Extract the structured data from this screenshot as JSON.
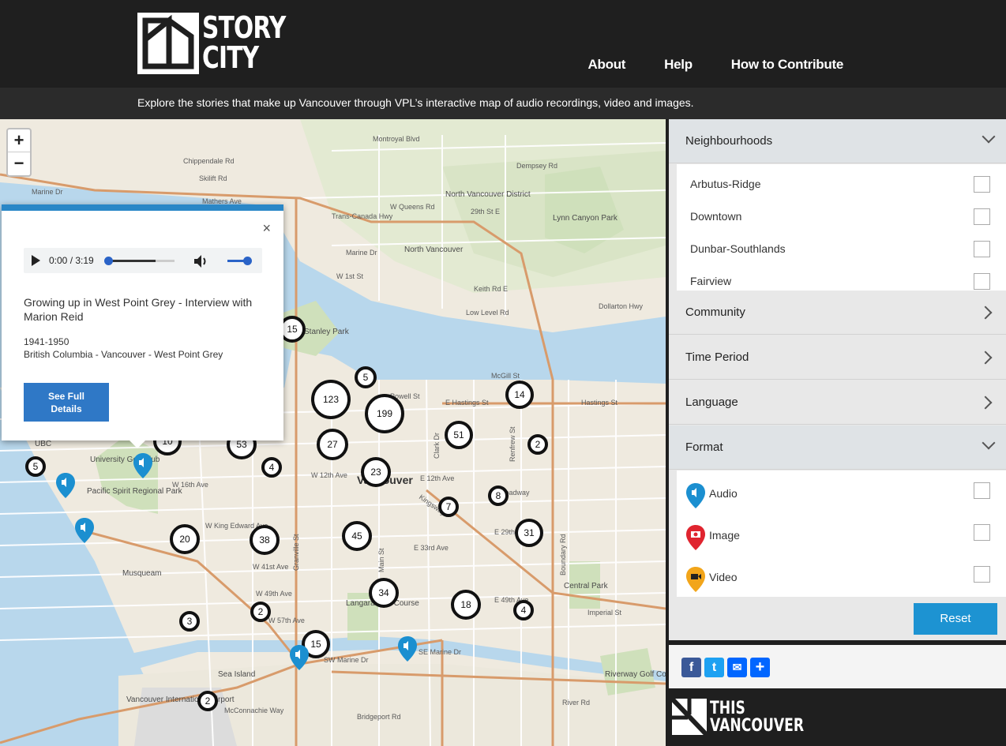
{
  "header": {
    "logo_line1": "STORY",
    "logo_line2": "CITY",
    "nav": [
      "About",
      "Help",
      "How to Contribute"
    ],
    "tagline": "Explore the stories that make up Vancouver through VPL’s interactive map of audio recordings, video and images."
  },
  "map": {
    "zoom_in": "+",
    "zoom_out": "−",
    "place_labels": [
      {
        "text": "North Vancouver District"
      },
      {
        "text": "North Vancouver"
      },
      {
        "text": "Lynn Canyon Park"
      },
      {
        "text": "UBC"
      },
      {
        "text": "University Golf Club"
      },
      {
        "text": "Pacific Spirit Regional Park"
      },
      {
        "text": "Vancouver"
      },
      {
        "text": "Musqueam"
      },
      {
        "text": "Langara Golf Course"
      },
      {
        "text": "Central Park"
      },
      {
        "text": "Sea Island"
      },
      {
        "text": "Vancouver International Airport"
      },
      {
        "text": "Riverway Golf Course"
      },
      {
        "text": "Stanley Park"
      }
    ],
    "street_labels": [
      {
        "text": "Marine Dr"
      },
      {
        "text": "Mathers Ave"
      },
      {
        "text": "Chippendale Rd"
      },
      {
        "text": "Skilift Rd"
      },
      {
        "text": "Montroyal Blvd"
      },
      {
        "text": "Dempsey Rd"
      },
      {
        "text": "W Queens Rd"
      },
      {
        "text": "29th St E"
      },
      {
        "text": "Trans-Canada Hwy"
      },
      {
        "text": "Marine Dr"
      },
      {
        "text": "W 1st St"
      },
      {
        "text": "Keith Rd E"
      },
      {
        "text": "Low Level Rd"
      },
      {
        "text": "Dollarton Hwy"
      },
      {
        "text": "Powell St"
      },
      {
        "text": "E Hastings St"
      },
      {
        "text": "Hastings St"
      },
      {
        "text": "McGill St"
      },
      {
        "text": "W 12th Ave"
      },
      {
        "text": "E 12th Ave"
      },
      {
        "text": "E Broadway"
      },
      {
        "text": "W 16th Ave"
      },
      {
        "text": "W King Edward Ave"
      },
      {
        "text": "W 41st Ave"
      },
      {
        "text": "E 33rd Ave"
      },
      {
        "text": "E 29th St"
      },
      {
        "text": "W 49th Ave"
      },
      {
        "text": "E 49th Ave"
      },
      {
        "text": "W 57th Ave"
      },
      {
        "text": "SW Marine Dr"
      },
      {
        "text": "SE Marine Dr"
      },
      {
        "text": "Imperial St"
      },
      {
        "text": "Granville St"
      },
      {
        "text": "Main St"
      },
      {
        "text": "Clark Dr"
      },
      {
        "text": "Renfrew St"
      },
      {
        "text": "Boundary Rd"
      },
      {
        "text": "Kingsway"
      },
      {
        "text": "McConnachie Way"
      },
      {
        "text": "Bridgeport Rd"
      },
      {
        "text": "River Rd"
      }
    ],
    "clusters": [
      {
        "n": "15"
      },
      {
        "n": "5"
      },
      {
        "n": "123"
      },
      {
        "n": "199"
      },
      {
        "n": "14"
      },
      {
        "n": "27"
      },
      {
        "n": "51"
      },
      {
        "n": "2"
      },
      {
        "n": "53"
      },
      {
        "n": "10"
      },
      {
        "n": "4"
      },
      {
        "n": "23"
      },
      {
        "n": "7"
      },
      {
        "n": "8"
      },
      {
        "n": "5"
      },
      {
        "n": "20"
      },
      {
        "n": "38"
      },
      {
        "n": "45"
      },
      {
        "n": "31"
      },
      {
        "n": "34"
      },
      {
        "n": "18"
      },
      {
        "n": "4"
      },
      {
        "n": "2"
      },
      {
        "n": "3"
      },
      {
        "n": "15"
      },
      {
        "n": "2"
      }
    ]
  },
  "popup": {
    "close": "×",
    "time": "0:00 / 3:19",
    "title": "Growing up in West Point Grey - Interview with Marion Reid",
    "date": "1941-1950",
    "location": "British Columbia - Vancouver - West Point Grey",
    "button_line1": "See Full",
    "button_line2": "Details"
  },
  "filters": {
    "neighbourhoods": {
      "title": "Neighbourhoods",
      "items": [
        "Arbutus-Ridge",
        "Downtown",
        "Dunbar-Southlands",
        "Fairview"
      ]
    },
    "community": "Community",
    "time_period": "Time Period",
    "language": "Language",
    "format": {
      "title": "Format",
      "items": [
        {
          "label": "Audio",
          "color": "#1b8fd0"
        },
        {
          "label": "Image",
          "color": "#e0242f"
        },
        {
          "label": "Video",
          "color": "#f2a51a"
        }
      ]
    },
    "reset": "Reset"
  },
  "share": {
    "facebook": "f",
    "twitter": "t",
    "email": "✉",
    "share": "+"
  },
  "footer_logo": {
    "line1": "THIS",
    "line2": "VANCOUVER"
  },
  "colors": {
    "header": "#1f1f1f",
    "accent": "#1d93d2",
    "water": "#b8d7ec",
    "audio": "#1b8fd0"
  }
}
